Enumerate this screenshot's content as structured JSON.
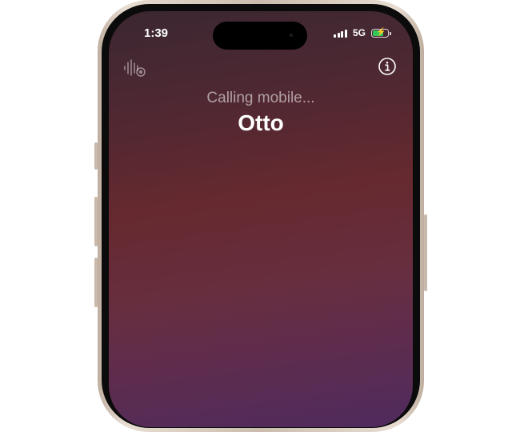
{
  "status_bar": {
    "time": "1:39",
    "network": "5G",
    "signal_icon": "cellular-signal-icon",
    "battery_icon": "battery-charging-icon",
    "battery_color": "#34c759"
  },
  "call": {
    "status": "Calling mobile...",
    "contact_name": "Otto"
  },
  "icons": {
    "live_voicemail": "live-voicemail-icon",
    "info": "info-icon"
  },
  "colors": {
    "gradient_top": "#3b2731",
    "gradient_mid": "#66292f",
    "gradient_bottom": "#4f2b5d"
  }
}
